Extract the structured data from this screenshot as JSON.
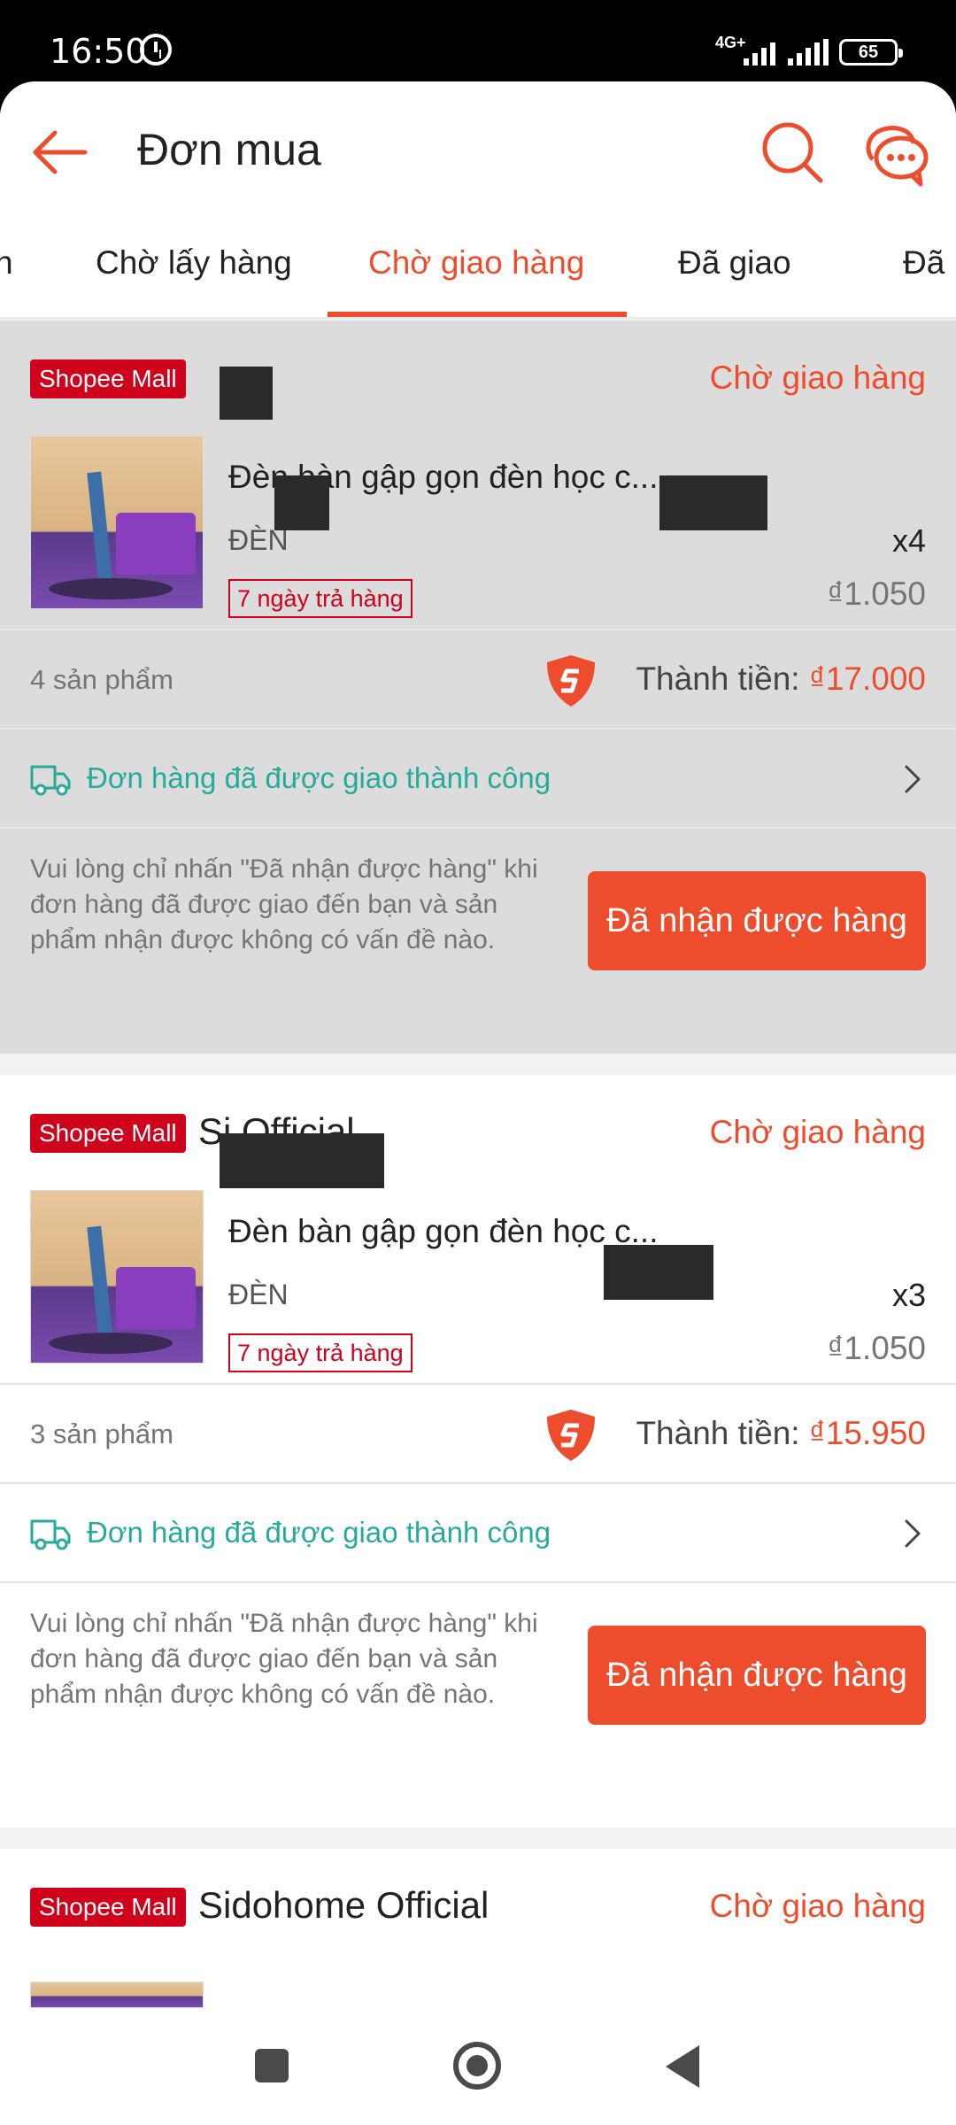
{
  "status_bar": {
    "time": "16:50",
    "network": "4G+",
    "battery": "65"
  },
  "header": {
    "title": "Đơn mua"
  },
  "tabs": [
    {
      "label": "n"
    },
    {
      "label": "Chờ lấy hàng"
    },
    {
      "label": "Chờ giao hàng",
      "active": true
    },
    {
      "label": "Đã giao"
    },
    {
      "label": "Đã"
    }
  ],
  "orders": [
    {
      "badge": "Shopee Mall",
      "shop_name": "",
      "status": "Chờ giao hàng",
      "product_name": "Đèn bàn gập gọn đèn học c...",
      "variation": "ĐÈN",
      "quantity": "x4",
      "return_policy": "7 ngày trả hàng",
      "unit_price": "₫1.050",
      "item_count": "4 sản phẩm",
      "total_label": "Thành tiền: ",
      "total_value": "₫17.000",
      "shipping_text": "Đơn hàng đã được giao thành công",
      "confirm_note": "Vui lòng chỉ nhấn \"Đã nhận được hàng\" khi đơn hàng đã được giao đến bạn và sản phẩm nhận được không có vấn đề nào.",
      "confirm_button": "Đã nhận được hàng"
    },
    {
      "badge": "Shopee Mall",
      "shop_name": "Si      Official",
      "status": "Chờ giao hàng",
      "product_name": "Đèn bàn gập gọn đèn học c...",
      "variation": "ĐÈN",
      "quantity": "x3",
      "return_policy": "7 ngày trả hàng",
      "unit_price": "₫1.050",
      "item_count": "3 sản phẩm",
      "total_label": "Thành tiền: ",
      "total_value": "₫15.950",
      "shipping_text": "Đơn hàng đã được giao thành công",
      "confirm_note": "Vui lòng chỉ nhấn \"Đã nhận được hàng\" khi đơn hàng đã được giao đến bạn và sản phẩm nhận được không có vấn đề nào.",
      "confirm_button": "Đã nhận được hàng"
    },
    {
      "badge": "Shopee Mall",
      "shop_name": "Sidohome Official",
      "status": "Chờ giao hàng"
    }
  ],
  "colors": {
    "accent": "#ee4d2d",
    "mall_red": "#d0011b",
    "teal": "#26aa99"
  },
  "icons": [
    "back-arrow-icon",
    "search-icon",
    "chat-icon",
    "shield-icon",
    "truck-icon",
    "chevron-right-icon"
  ]
}
